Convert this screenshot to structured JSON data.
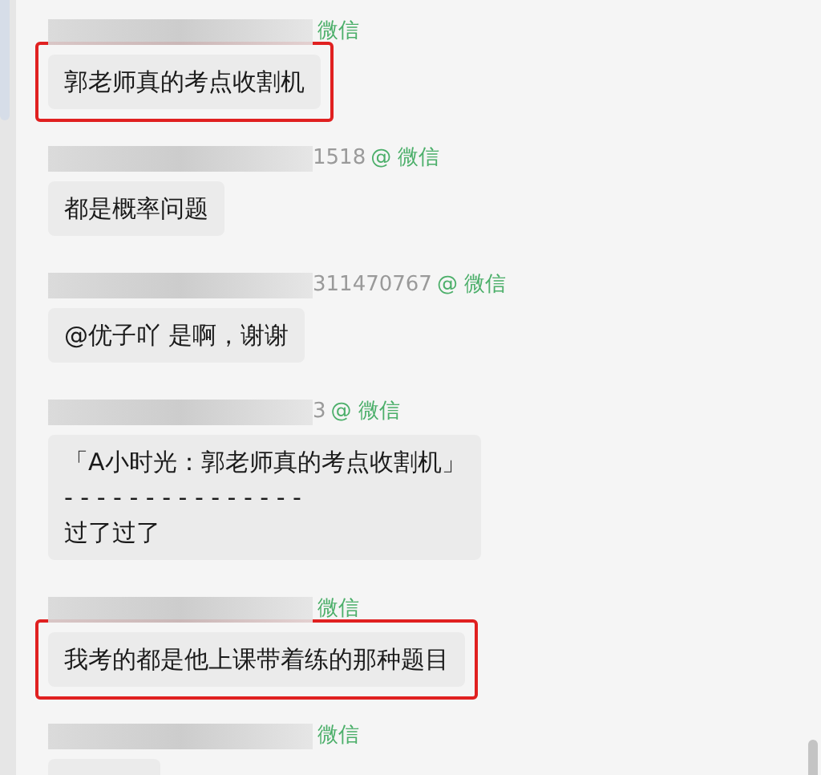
{
  "messages": [
    {
      "source": "微信",
      "kind": "text",
      "lines": [
        "郭老师真的考点收割机"
      ],
      "highlighted": true
    },
    {
      "sender_suffix": "1518",
      "source": "@ 微信",
      "kind": "text",
      "lines": [
        "都是概率问题"
      ],
      "highlighted": false
    },
    {
      "sender_suffix": "311470767",
      "source": "@ 微信",
      "kind": "text",
      "lines": [
        "@优子吖 是啊，谢谢"
      ],
      "highlighted": false
    },
    {
      "sender_suffix": "3",
      "source": "@ 微信",
      "kind": "quote",
      "lines": [
        "「A小时光：郭老师真的考点收割机」",
        "- - - - - - - - - - - - - - -",
        "过了过了"
      ],
      "highlighted": false
    },
    {
      "source": "微信",
      "kind": "text",
      "lines": [
        "我考的都是他上课带着练的那种题目"
      ],
      "highlighted": true
    },
    {
      "source": "微信",
      "kind": "cut",
      "highlighted": false
    }
  ]
}
